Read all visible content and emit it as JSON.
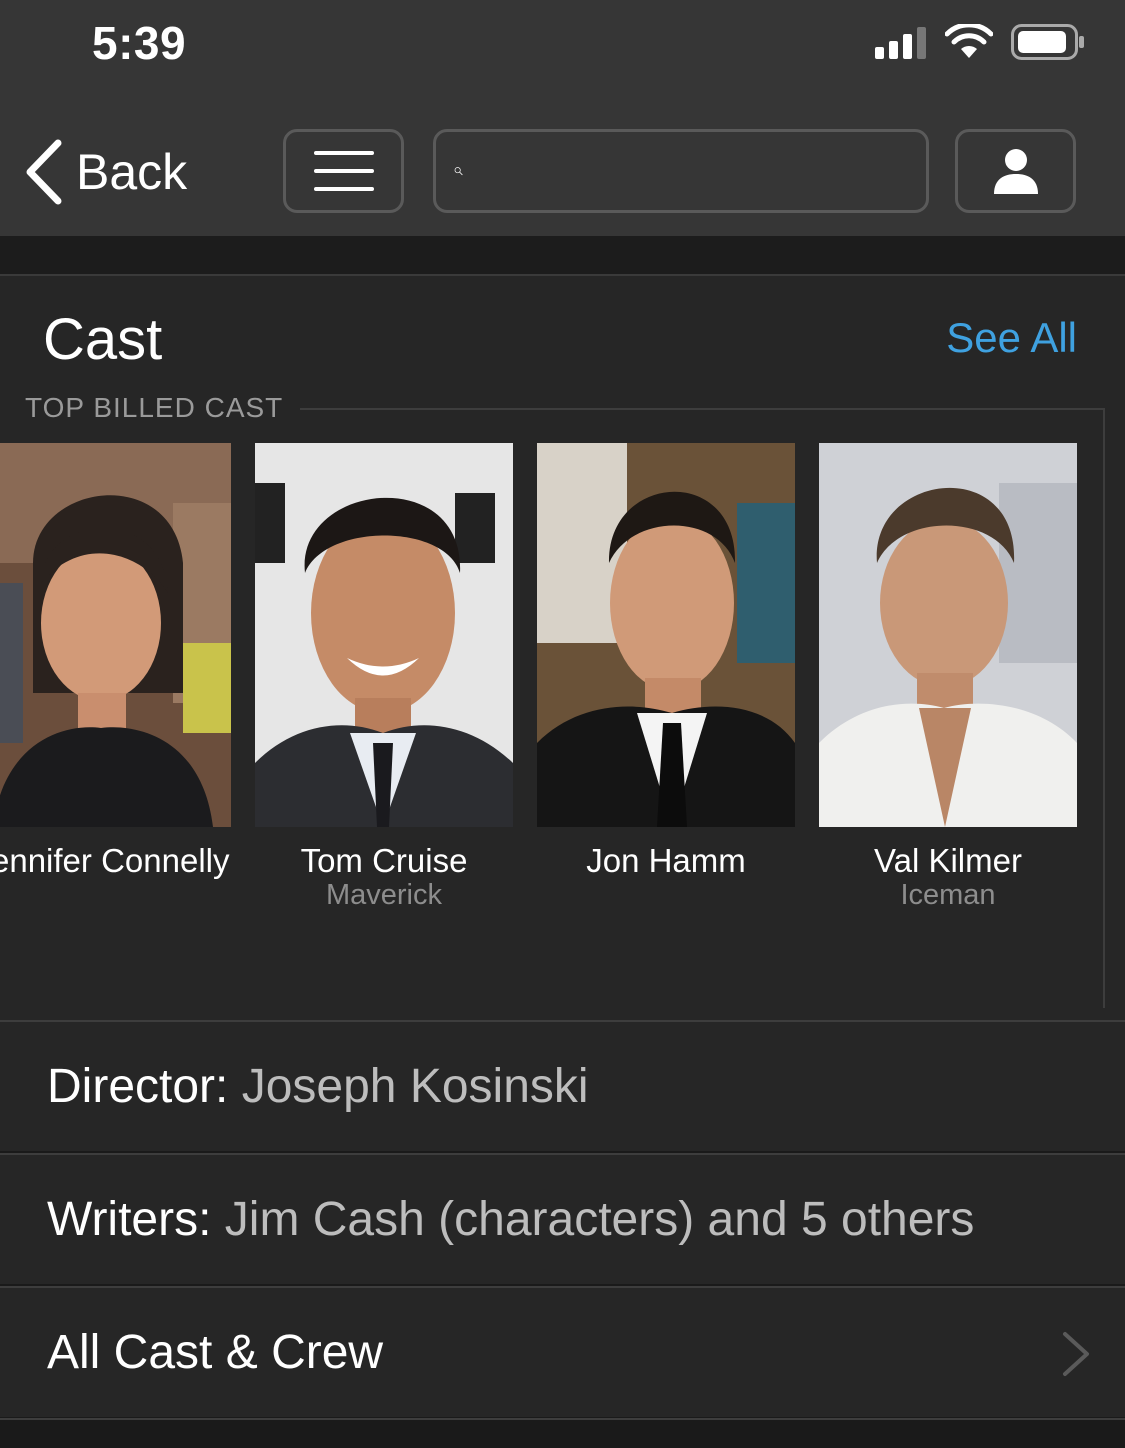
{
  "status_bar": {
    "time": "5:39"
  },
  "nav": {
    "back_label": "Back",
    "search_placeholder": ""
  },
  "cast": {
    "title": "Cast",
    "see_all": "See All",
    "subheading": "TOP BILLED CAST",
    "members": [
      {
        "name": "Jennifer Connelly",
        "role": ""
      },
      {
        "name": "Tom Cruise",
        "role": "Maverick"
      },
      {
        "name": "Jon Hamm",
        "role": ""
      },
      {
        "name": "Val Kilmer",
        "role": "Iceman"
      }
    ]
  },
  "credits": {
    "director_label": "Director:",
    "director_value": "Joseph Kosinski",
    "writers_label": "Writers:",
    "writers_value": "Jim Cash (characters) and 5 others",
    "all_cast_crew": "All Cast & Crew"
  },
  "colors": {
    "accent": "#3fa1e0",
    "background": "#262626",
    "topbar": "#363636"
  }
}
